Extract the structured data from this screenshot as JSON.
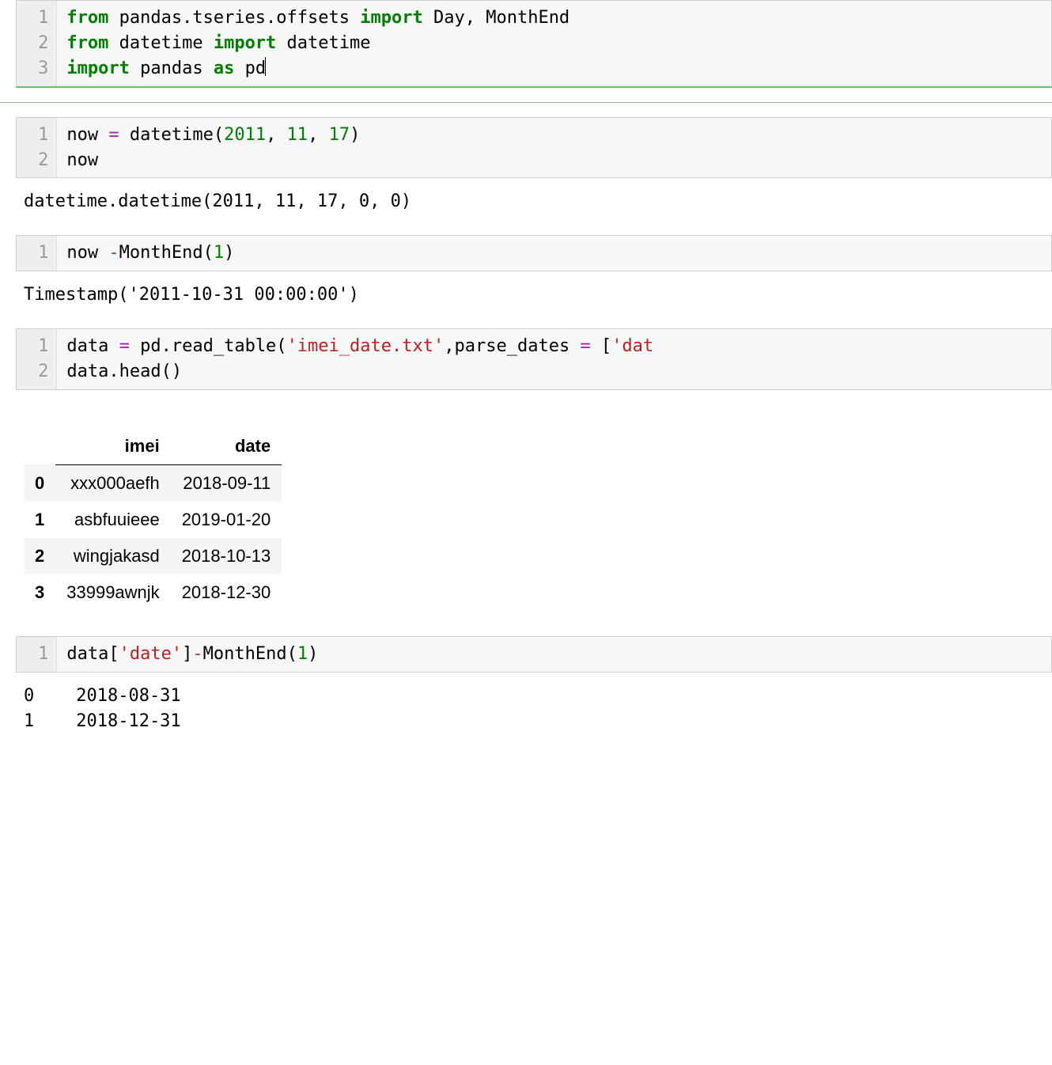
{
  "cells": [
    {
      "lines": [
        {
          "tokens": [
            [
              "kw",
              "from"
            ],
            [
              "",
              " pandas.tseries.offsets "
            ],
            [
              "kw",
              "import"
            ],
            [
              "",
              " Day, MonthEnd"
            ]
          ]
        },
        {
          "tokens": [
            [
              "kw",
              "from"
            ],
            [
              "",
              " datetime "
            ],
            [
              "kw",
              "import"
            ],
            [
              "",
              " datetime"
            ]
          ]
        },
        {
          "tokens": [
            [
              "kw",
              "import"
            ],
            [
              "",
              " pandas "
            ],
            [
              "kw",
              "as"
            ],
            [
              "",
              " pd"
            ],
            [
              "cursor",
              ""
            ]
          ]
        }
      ],
      "output": null,
      "first": true
    },
    {
      "lines": [
        {
          "tokens": [
            [
              "",
              "now "
            ],
            [
              "op",
              "="
            ],
            [
              "",
              " datetime("
            ],
            [
              "num",
              "2011"
            ],
            [
              "",
              ", "
            ],
            [
              "num",
              "11"
            ],
            [
              "",
              ", "
            ],
            [
              "num",
              "17"
            ],
            [
              "",
              ")"
            ]
          ]
        },
        {
          "tokens": [
            [
              "",
              "now"
            ]
          ]
        }
      ],
      "output": "datetime.datetime(2011, 11, 17, 0, 0)"
    },
    {
      "lines": [
        {
          "tokens": [
            [
              "",
              "now "
            ],
            [
              "op",
              "-"
            ],
            [
              "",
              "MonthEnd("
            ],
            [
              "num",
              "1"
            ],
            [
              "",
              ")"
            ]
          ]
        }
      ],
      "output": "Timestamp('2011-10-31 00:00:00')"
    },
    {
      "lines": [
        {
          "tokens": [
            [
              "",
              "data "
            ],
            [
              "op",
              "="
            ],
            [
              "",
              " pd.read_table("
            ],
            [
              "str",
              "'imei_date.txt'"
            ],
            [
              "",
              ",parse_dates "
            ],
            [
              "op",
              "="
            ],
            [
              "",
              " ["
            ],
            [
              "str",
              "'dat"
            ]
          ]
        },
        {
          "tokens": [
            [
              "",
              "data.head()"
            ]
          ]
        }
      ],
      "output": null,
      "dataframe": true
    },
    {
      "lines": [
        {
          "tokens": [
            [
              "",
              "data["
            ],
            [
              "str",
              "'date'"
            ],
            [
              "",
              "]"
            ],
            [
              "op",
              "-"
            ],
            [
              "",
              "MonthEnd("
            ],
            [
              "num",
              "1"
            ],
            [
              "",
              ")"
            ]
          ]
        }
      ],
      "output": "0    2018-08-31\n1    2018-12-31"
    }
  ],
  "dataframe": {
    "columns": [
      "imei",
      "date"
    ],
    "index": [
      "0",
      "1",
      "2",
      "3"
    ],
    "rows": [
      [
        "xxx000aefh",
        "2018-09-11"
      ],
      [
        "asbfuuieee",
        "2019-01-20"
      ],
      [
        "wingjakasd",
        "2018-10-13"
      ],
      [
        "33999awnjk",
        "2018-12-30"
      ]
    ]
  }
}
